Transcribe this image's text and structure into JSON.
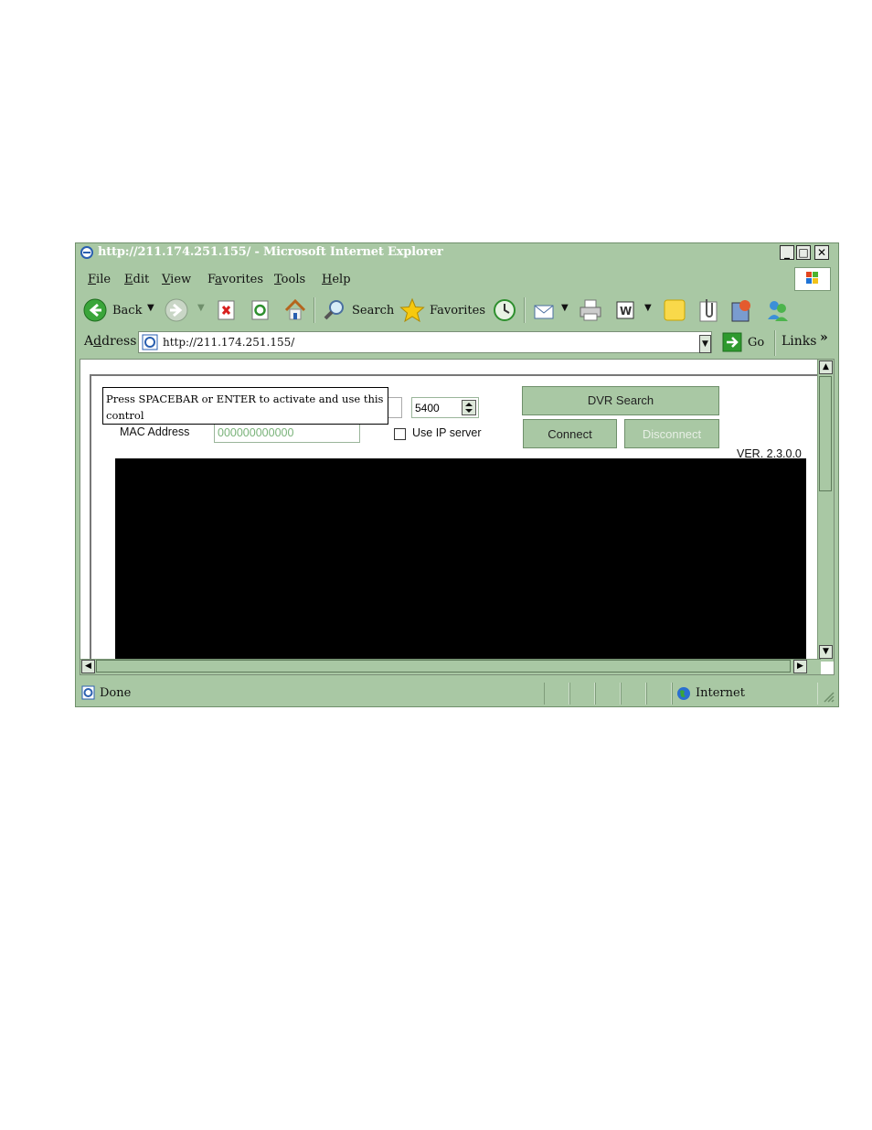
{
  "window": {
    "title": "http://211.174.251.155/ - Microsoft Internet Explorer",
    "controls": {
      "minimize": "_",
      "maximize": "□",
      "close": "✕"
    }
  },
  "menu": {
    "items": [
      {
        "pre": "",
        "key": "F",
        "post": "ile"
      },
      {
        "pre": "",
        "key": "E",
        "post": "dit"
      },
      {
        "pre": "",
        "key": "V",
        "post": "iew"
      },
      {
        "pre": "F",
        "key": "a",
        "post": "vorites"
      },
      {
        "pre": "",
        "key": "T",
        "post": "ools"
      },
      {
        "pre": "",
        "key": "H",
        "post": "elp"
      }
    ]
  },
  "toolbar": {
    "back_label": "Back",
    "search_label": "Search",
    "favorites_label": "Favorites"
  },
  "address": {
    "label_pre": "A",
    "label_key": "d",
    "label_post": "dress",
    "url": "http://211.174.251.155/",
    "go_label": "Go",
    "links_label": "Links",
    "links_more": "»"
  },
  "page": {
    "tooltip": "Press SPACEBAR or ENTER to activate and use this control",
    "port_value": "5400",
    "mac_label": "MAC Address",
    "mac_value": "000000000000",
    "use_ip_label": "Use IP server",
    "dvr_search_label": "DVR Search",
    "connect_label": "Connect",
    "disconnect_label": "Disconnect",
    "version": "VER. 2.3.0.0"
  },
  "status": {
    "text": "Done",
    "zone": "Internet"
  },
  "colors": {
    "chrome": "#a9c8a4",
    "video": "#000000",
    "disabled_text": "#e7efe5"
  }
}
